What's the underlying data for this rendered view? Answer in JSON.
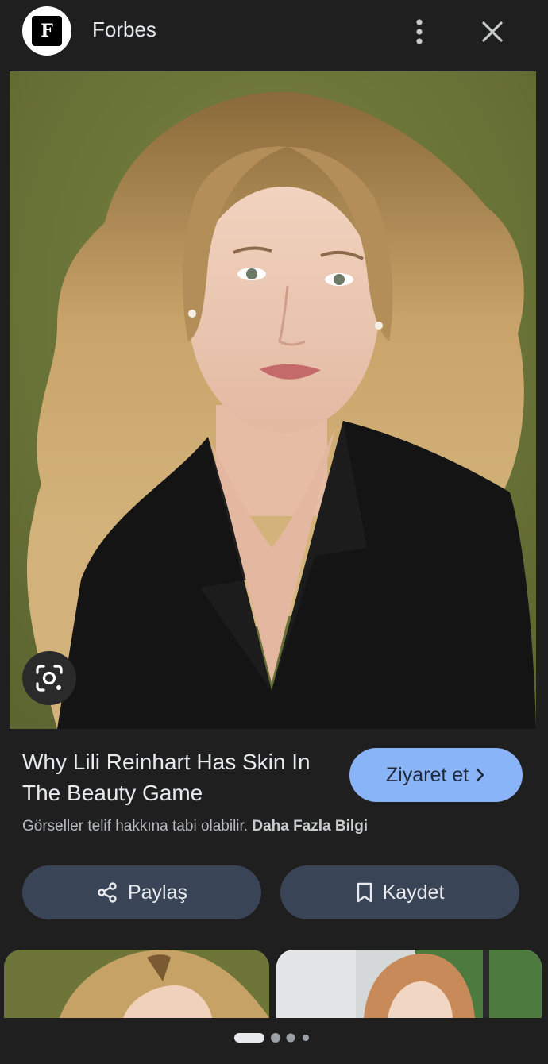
{
  "header": {
    "logo_letter": "F",
    "source_name": "Forbes",
    "more_icon": "more-vert-icon",
    "close_icon": "close-icon"
  },
  "main_image": {
    "lens_icon": "google-lens-icon"
  },
  "details": {
    "title": "Why Lili Reinhart Has Skin In The Beauty Game",
    "visit_label": "Ziyaret et",
    "copyright_text": "Görseller telif hakkına tabi olabilir.",
    "learn_more": "Daha Fazla Bilgi"
  },
  "actions": {
    "share_label": "Paylaş",
    "save_label": "Kaydet"
  },
  "pager": {
    "count": 4,
    "active": 0
  },
  "colors": {
    "accent": "#8ab4f8",
    "background": "#1f1f1f",
    "action_button": "#394457"
  }
}
